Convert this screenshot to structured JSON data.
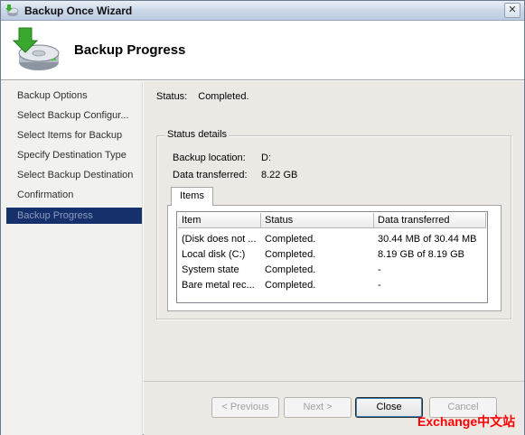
{
  "window": {
    "title": "Backup Once Wizard",
    "close_glyph": "✕"
  },
  "header": {
    "title": "Backup Progress",
    "icon": "backup-disk-icon"
  },
  "nav": {
    "items": [
      {
        "label": "Backup Options"
      },
      {
        "label": "Select Backup Configur..."
      },
      {
        "label": "Select Items for Backup"
      },
      {
        "label": "Specify Destination Type"
      },
      {
        "label": "Select Backup Destination"
      },
      {
        "label": "Confirmation"
      },
      {
        "label": "Backup Progress"
      }
    ],
    "active_index": 6,
    "active_color": "#16306b"
  },
  "status": {
    "label": "Status:",
    "value": "Completed."
  },
  "details": {
    "title": "Status details",
    "backup_location_label": "Backup location:",
    "backup_location_value": "D:",
    "data_transferred_label": "Data transferred:",
    "data_transferred_value": "8.22 GB",
    "tab_label": "Items",
    "columns": [
      "Item",
      "Status",
      "Data transferred"
    ],
    "rows": [
      [
        "(Disk does not ...",
        "Completed.",
        "30.44 MB of 30.44 MB"
      ],
      [
        "Local disk (C:)",
        "Completed.",
        "8.19 GB of 8.19 GB"
      ],
      [
        "System state",
        "Completed.",
        "-"
      ],
      [
        "Bare metal rec...",
        "Completed.",
        "-"
      ]
    ]
  },
  "buttons": {
    "previous": "< Previous",
    "next": "Next >",
    "close": "Close",
    "cancel": "Cancel"
  },
  "watermark": "Exchange中文站"
}
